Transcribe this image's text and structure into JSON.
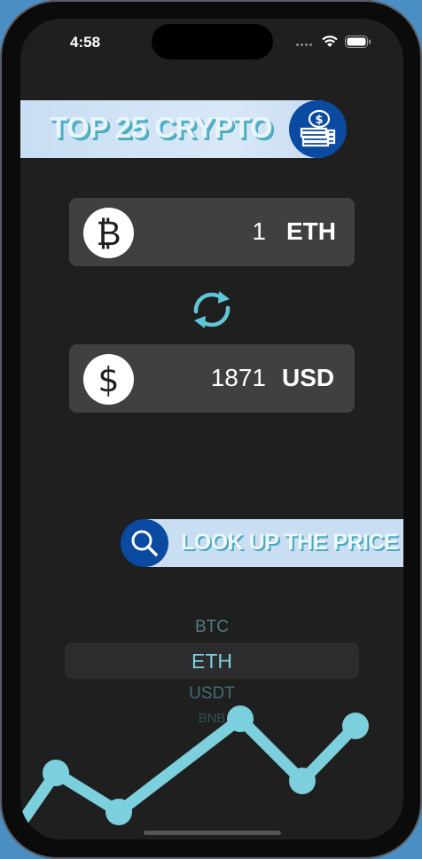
{
  "status_bar": {
    "time": "4:58"
  },
  "banner": {
    "title": "TOP 25 CRYPTO",
    "icon": "coin-stack-icon"
  },
  "converter": {
    "from": {
      "icon": "bitcoin-icon",
      "symbol": "₿",
      "amount": "1",
      "currency": "ETH"
    },
    "swap_icon": "swap-arrows-icon",
    "to": {
      "icon": "dollar-icon",
      "symbol": "$",
      "amount": "1871",
      "currency": "USD"
    }
  },
  "lookup": {
    "label": "LOOK UP THE PRICE",
    "icon": "search-icon"
  },
  "picker": {
    "items": [
      "BTC",
      "ETH",
      "USDT",
      "BNB"
    ],
    "selected": "ETH"
  },
  "colors": {
    "accent": "#7ccfdc",
    "brand_blue": "#0a4aa1",
    "banner_bg": "#c9def3",
    "field_bg": "#404040",
    "background": "#1f1f1f"
  }
}
